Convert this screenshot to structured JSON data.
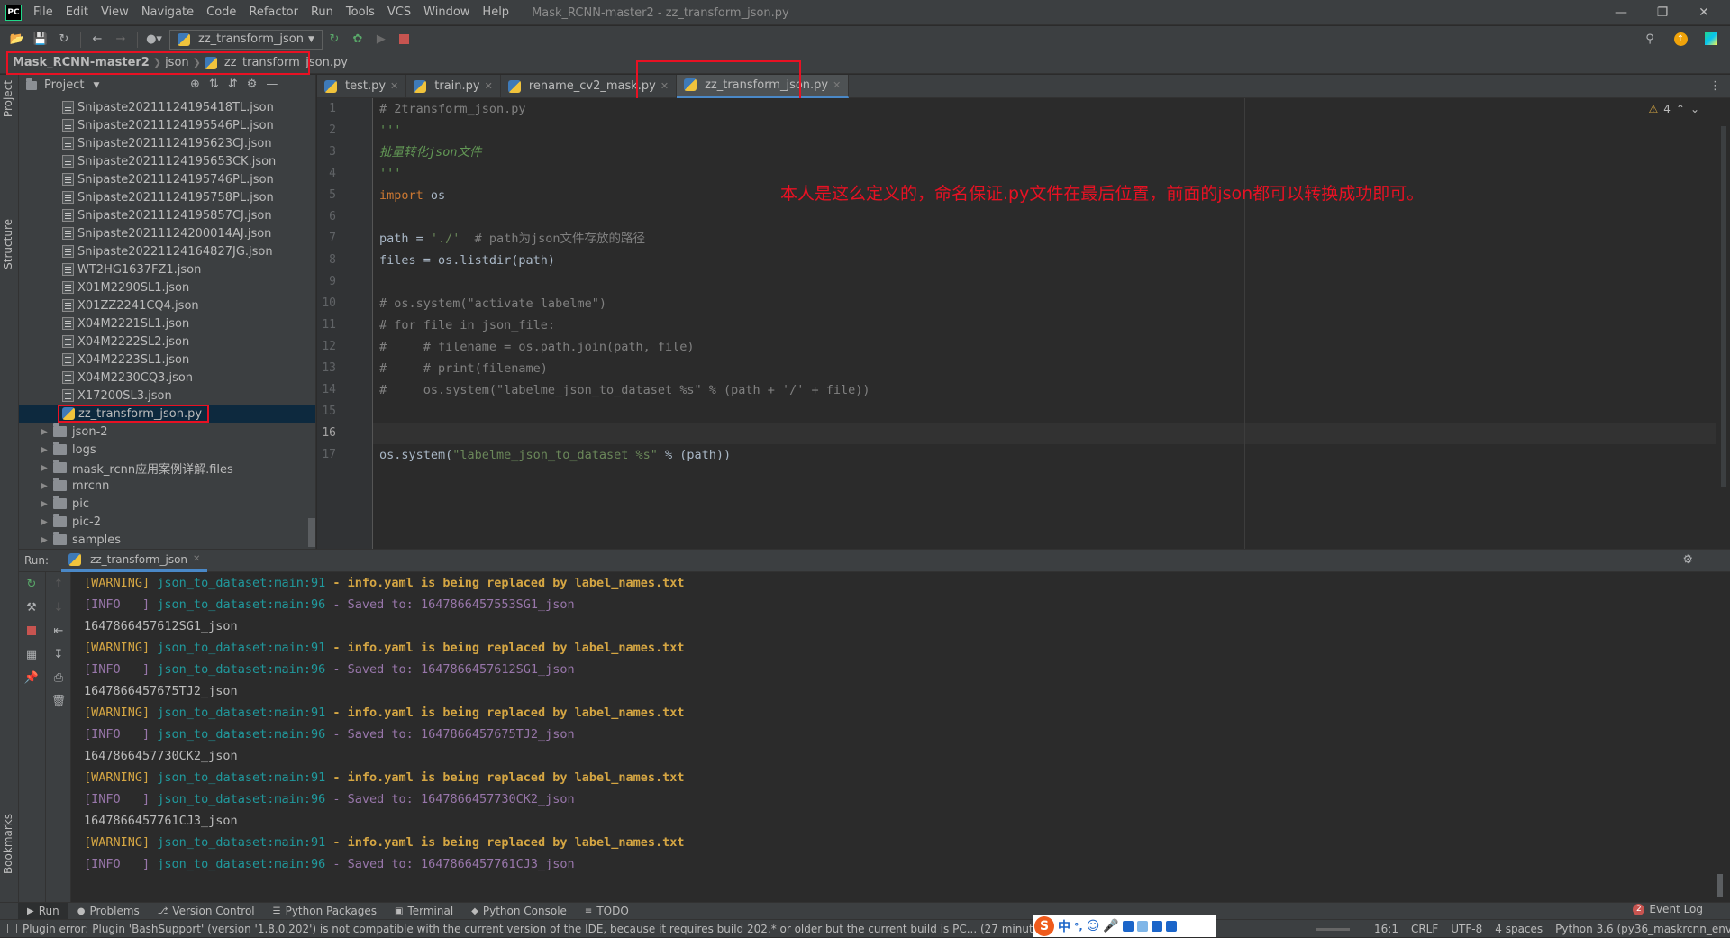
{
  "app": {
    "logo_text": "PC",
    "window_title": "Mask_RCNN-master2 - zz_transform_json.py"
  },
  "menu": [
    "File",
    "Edit",
    "View",
    "Navigate",
    "Code",
    "Refactor",
    "Run",
    "Tools",
    "VCS",
    "Window",
    "Help"
  ],
  "toolbar": {
    "run_config": "zz_transform_json"
  },
  "breadcrumb": {
    "project": "Mask_RCNN-master2",
    "folder": "json",
    "file": "zz_transform_json.py"
  },
  "left_strip": {
    "project": "Project",
    "structure": "Structure",
    "bookmarks": "Bookmarks"
  },
  "project_panel": {
    "title": "Project",
    "files": [
      "Snipaste20211124195418TL.json",
      "Snipaste20211124195546PL.json",
      "Snipaste20211124195623CJ.json",
      "Snipaste20211124195653CK.json",
      "Snipaste20211124195746PL.json",
      "Snipaste20211124195758PL.json",
      "Snipaste20211124195857CJ.json",
      "Snipaste20211124200014AJ.json",
      "Snipaste20221124164827JG.json",
      "WT2HG1637FZ1.json",
      "X01M2290SL1.json",
      "X01ZZ2241CQ4.json",
      "X04M2221SL1.json",
      "X04M2222SL2.json",
      "X04M2223SL1.json",
      "X04M2230CQ3.json",
      "X17200SL3.json"
    ],
    "selected_file": "zz_transform_json.py",
    "folders": [
      "json-2",
      "logs",
      "mask_rcnn应用案例详解.files",
      "mrcnn",
      "pic",
      "pic-2",
      "samples"
    ]
  },
  "tabs": [
    "test.py",
    "train.py",
    "rename_cv2_mask.py",
    "zz_transform_json.py"
  ],
  "editor": {
    "line_numbers": [
      "1",
      "2",
      "3",
      "4",
      "5",
      "6",
      "7",
      "8",
      "9",
      "10",
      "11",
      "12",
      "13",
      "14",
      "15",
      "16",
      "17"
    ],
    "current_line": "16",
    "warnings": "4",
    "code": {
      "l1": "# 2transform_json.py",
      "l2": "'''",
      "l3": "批量转化json文件",
      "l4": "'''",
      "l5_kw": "import",
      "l5_rest": " os",
      "l7_a": "path = ",
      "l7_str": "'./'",
      "l7_cmt": "  # path为json文件存放的路径",
      "l8": "files = os.listdir(path)",
      "l10": "# os.system(\"activate labelme\")",
      "l11": "# for file in json_file:",
      "l12": "#     # filename = os.path.join(path, file)",
      "l13": "#     # print(filename)",
      "l14": "#     os.system(\"labelme_json_to_dataset %s\" % (path + '/' + file))",
      "l17_a": "os.system(",
      "l17_str": "\"labelme_json_to_dataset %s\"",
      "l17_b": " % (path))"
    },
    "annotation": "本人是这么定义的，命名保证.py文件在最后位置，前面的json都可以转换成功即可。"
  },
  "run_panel": {
    "label": "Run:",
    "tab": "zz_transform_json",
    "lines": [
      {
        "kind": "warn",
        "tag": "[WARNING]",
        "mod": "json_to_dataset",
        "fn": "main",
        "num": "91",
        "msg": " - info.yaml is being replaced by label_names.txt"
      },
      {
        "kind": "info",
        "tag": "[INFO   ]",
        "mod": "json_to_dataset",
        "fn": "main",
        "num": "96",
        "msg": " - Saved to: 1647866457553SG1_json"
      },
      {
        "kind": "plain",
        "text": "1647866457612SG1_json"
      },
      {
        "kind": "warn",
        "tag": "[WARNING]",
        "mod": "json_to_dataset",
        "fn": "main",
        "num": "91",
        "msg": " - info.yaml is being replaced by label_names.txt"
      },
      {
        "kind": "info",
        "tag": "[INFO   ]",
        "mod": "json_to_dataset",
        "fn": "main",
        "num": "96",
        "msg": " - Saved to: 1647866457612SG1_json"
      },
      {
        "kind": "plain",
        "text": "1647866457675TJ2_json"
      },
      {
        "kind": "warn",
        "tag": "[WARNING]",
        "mod": "json_to_dataset",
        "fn": "main",
        "num": "91",
        "msg": " - info.yaml is being replaced by label_names.txt"
      },
      {
        "kind": "info",
        "tag": "[INFO   ]",
        "mod": "json_to_dataset",
        "fn": "main",
        "num": "96",
        "msg": " - Saved to: 1647866457675TJ2_json"
      },
      {
        "kind": "plain",
        "text": "1647866457730CK2_json"
      },
      {
        "kind": "warn",
        "tag": "[WARNING]",
        "mod": "json_to_dataset",
        "fn": "main",
        "num": "91",
        "msg": " - info.yaml is being replaced by label_names.txt"
      },
      {
        "kind": "info",
        "tag": "[INFO   ]",
        "mod": "json_to_dataset",
        "fn": "main",
        "num": "96",
        "msg": " - Saved to: 1647866457730CK2_json"
      },
      {
        "kind": "plain",
        "text": "1647866457761CJ3_json"
      },
      {
        "kind": "warn",
        "tag": "[WARNING]",
        "mod": "json_to_dataset",
        "fn": "main",
        "num": "91",
        "msg": " - info.yaml is being replaced by label_names.txt"
      },
      {
        "kind": "info",
        "tag": "[INFO   ]",
        "mod": "json_to_dataset",
        "fn": "main",
        "num": "96",
        "msg": " - Saved to: 1647866457761CJ3_json"
      }
    ]
  },
  "bottom_tabs": [
    "Run",
    "Problems",
    "Version Control",
    "Python Packages",
    "Terminal",
    "Python Console",
    "TODO"
  ],
  "event_log": {
    "count": "2",
    "label": "Event Log"
  },
  "status": {
    "message": "Plugin error: Plugin 'BashSupport' (version '1.8.0.202') is not compatible with the current version of the IDE, because it requires build 202.* or older but the current build is PC... (27 minutes ago)",
    "position": "16:1",
    "line_sep": "CRLF",
    "encoding": "UTF-8",
    "indent": "4 spaces",
    "interpreter": "Python 3.6 (py36_maskrcnn_env)"
  },
  "ime": {
    "logo": "S",
    "mode": "中",
    "punct": "°,"
  },
  "colors": {
    "highlight": "#e81123",
    "accent": "#4a88c7"
  }
}
